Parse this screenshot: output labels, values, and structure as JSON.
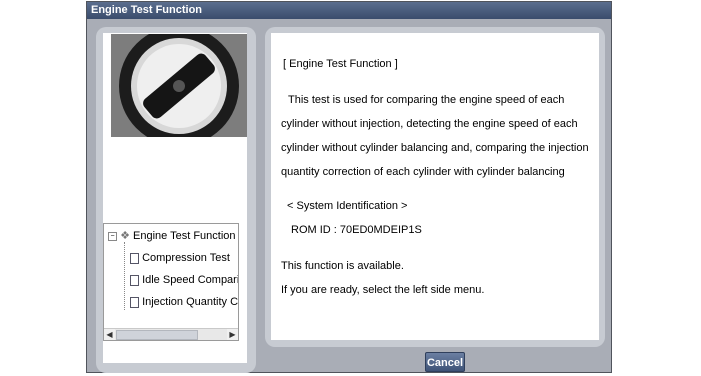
{
  "window": {
    "title": "Engine Test Function"
  },
  "photo": {
    "label": "Ignition key switch photo"
  },
  "tree": {
    "root": "Engine Test Function",
    "items": [
      "Compression Test",
      "Idle Speed Comparis",
      "Injection Quantity C"
    ]
  },
  "info": {
    "heading": "[ Engine Test Function ]",
    "lines": [
      "This test is used for comparing the engine speed of each",
      "cylinder without injection, detecting the engine speed of each",
      "cylinder without cylinder balancing and, comparing the injection",
      "quantity correction of each cylinder with cylinder balancing"
    ],
    "sys_heading": "< System Identification >",
    "rom_id": "ROM ID : 70ED0MDEIP1S",
    "status": "This function is available.",
    "instruction": "If you are ready, select the left side menu."
  },
  "buttons": {
    "cancel": "Cancel"
  }
}
